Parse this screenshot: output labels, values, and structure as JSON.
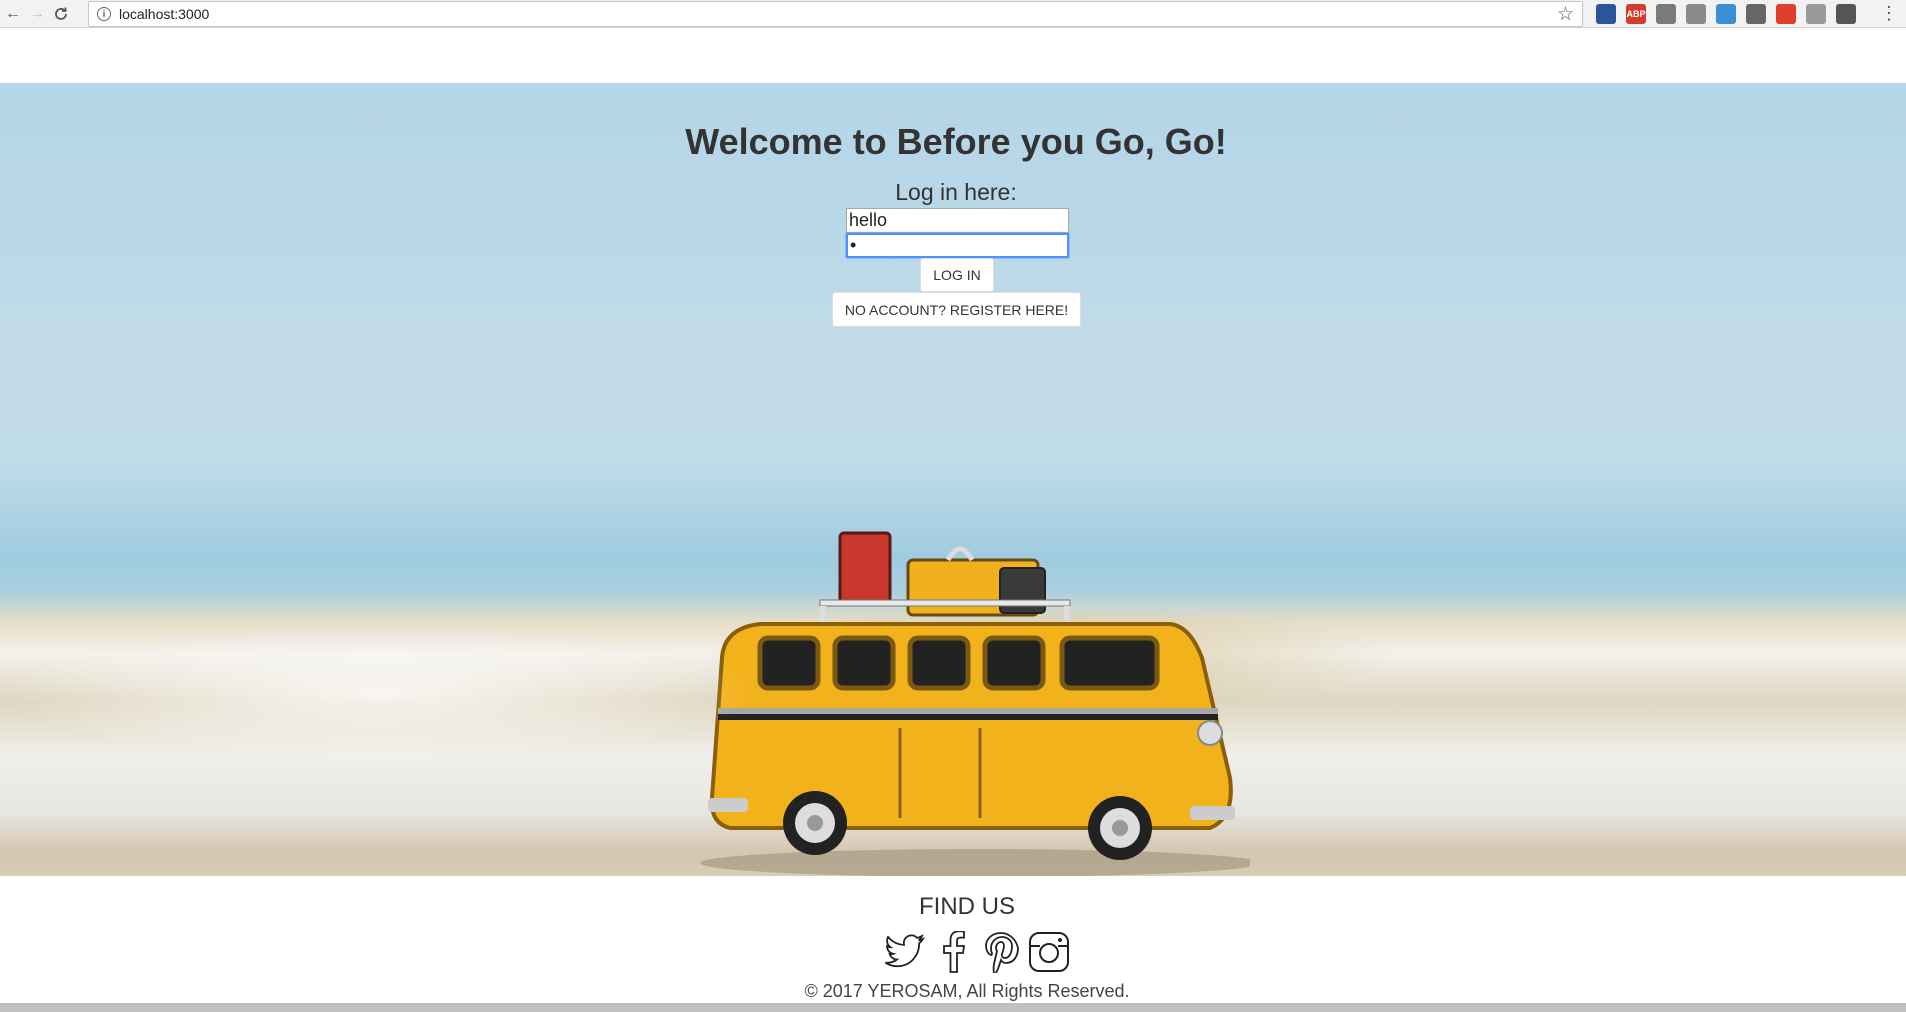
{
  "browser": {
    "url": "localhost:3000",
    "back_glyph": "←",
    "forward_glyph": "→",
    "reload_glyph": "C",
    "star_glyph": "☆",
    "menu_glyph": "⋮",
    "extensions": [
      {
        "name": "extension-1-icon",
        "label": "",
        "color": "#2a5699"
      },
      {
        "name": "adblock-icon",
        "label": "ABP",
        "color": "#d43a2f"
      },
      {
        "name": "ublock-icon",
        "label": "",
        "color": "#7a7a7a"
      },
      {
        "name": "extension-4-icon",
        "label": "",
        "color": "#8a8a8a"
      },
      {
        "name": "extension-5-icon",
        "label": "",
        "color": "#3b8fd1"
      },
      {
        "name": "extension-6-icon",
        "label": "",
        "color": "#666666"
      },
      {
        "name": "extension-7-icon",
        "label": "",
        "color": "#e03e2d"
      },
      {
        "name": "extension-8-icon",
        "label": "",
        "color": "#9a9a9a"
      },
      {
        "name": "extension-9-icon",
        "label": "",
        "color": "#555555"
      }
    ]
  },
  "hero": {
    "title": "Welcome to Before you Go, Go!",
    "login_label": "Log in here:",
    "username_value": "hello",
    "password_value": "•",
    "login_button": "LOG IN",
    "register_button": "NO ACCOUNT? REGISTER HERE!"
  },
  "footer": {
    "find_us": "FIND US",
    "socials": [
      "twitter-icon",
      "facebook-icon",
      "pinterest-icon",
      "instagram-icon"
    ],
    "copyright": "© 2017 YEROSAM, All Rights Reserved."
  },
  "colors": {
    "sky": "#b5d6e8",
    "bus_yellow": "#f2b21b",
    "focus_blue": "#4d90fe"
  }
}
